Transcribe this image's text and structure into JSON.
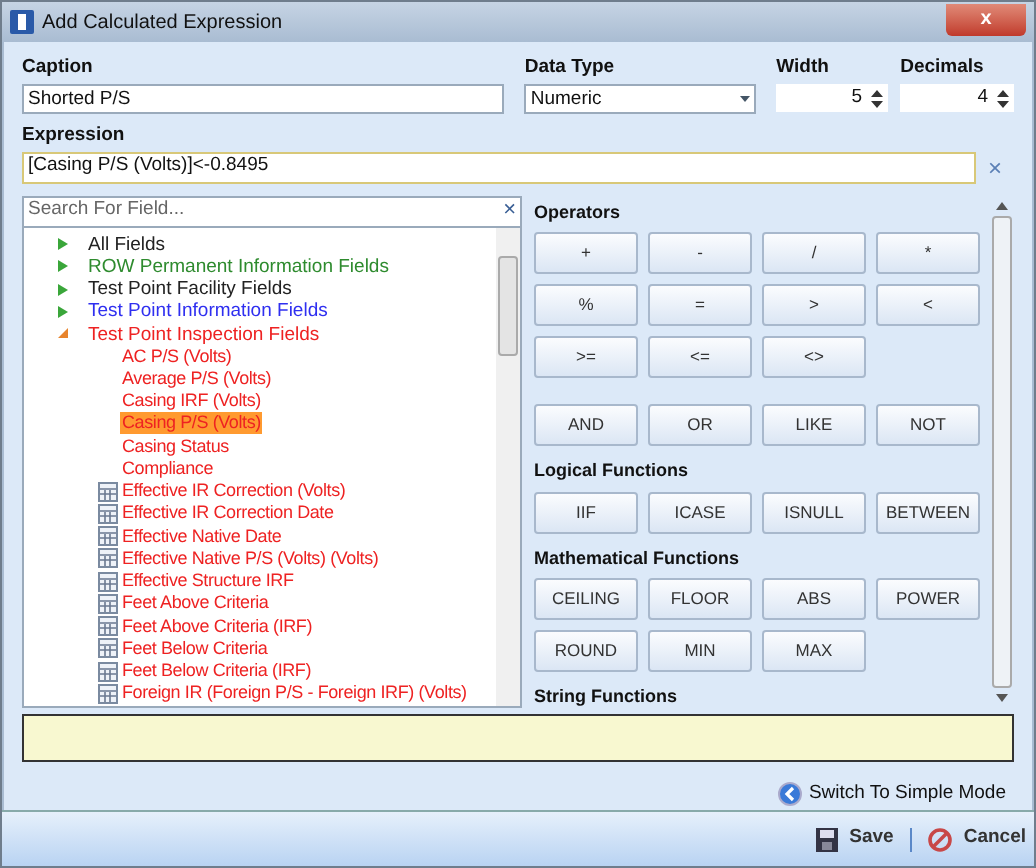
{
  "window": {
    "title": "Add Calculated Expression",
    "close": "x"
  },
  "caption": {
    "label": "Caption",
    "value": "Shorted P/S"
  },
  "data_type": {
    "label": "Data Type",
    "value": "Numeric"
  },
  "width": {
    "label": "Width",
    "value": "5"
  },
  "decimals": {
    "label": "Decimals",
    "value": "4"
  },
  "expression": {
    "label": "Expression",
    "value": "[Casing P/S (Volts)]<-0.8495",
    "clear": "×"
  },
  "search": {
    "placeholder": "Search For Field...",
    "clear": "×"
  },
  "tree": [
    {
      "label": "All Fields",
      "color": "#222222",
      "expanded": false
    },
    {
      "label": "ROW Permanent Information Fields",
      "color": "#2e8b2e",
      "expanded": false
    },
    {
      "label": "Test Point Facility Fields",
      "color": "#222222",
      "expanded": false
    },
    {
      "label": "Test Point Information Fields",
      "color": "#2f2ff0",
      "expanded": false
    },
    {
      "label": "Test Point Inspection Fields",
      "color": "#ee2222",
      "expanded": true,
      "children": [
        {
          "label": "AC P/S (Volts)",
          "kind": "plain",
          "selected": false
        },
        {
          "label": "Average P/S (Volts)",
          "kind": "plain",
          "selected": false
        },
        {
          "label": "Casing IRF (Volts)",
          "kind": "plain",
          "selected": false
        },
        {
          "label": "Casing P/S (Volts)",
          "kind": "plain",
          "selected": true
        },
        {
          "label": "Casing Status",
          "kind": "plain",
          "selected": false
        },
        {
          "label": "Compliance",
          "kind": "plain",
          "selected": false
        },
        {
          "label": "Effective IR Correction (Volts)",
          "kind": "table",
          "selected": false
        },
        {
          "label": "Effective IR Correction Date",
          "kind": "table",
          "selected": false
        },
        {
          "label": "Effective Native Date",
          "kind": "table",
          "selected": false
        },
        {
          "label": "Effective Native P/S (Volts) (Volts)",
          "kind": "table",
          "selected": false
        },
        {
          "label": "Effective Structure IRF",
          "kind": "table",
          "selected": false
        },
        {
          "label": "Feet Above Criteria",
          "kind": "table",
          "selected": false
        },
        {
          "label": "Feet Above Criteria (IRF)",
          "kind": "table",
          "selected": false
        },
        {
          "label": "Feet Below Criteria",
          "kind": "table",
          "selected": false
        },
        {
          "label": "Feet Below Criteria (IRF)",
          "kind": "table",
          "selected": false
        },
        {
          "label": "Foreign IR (Foreign P/S - Foreign IRF) (Volts)",
          "kind": "table",
          "selected": false
        }
      ]
    }
  ],
  "sections": [
    {
      "title": "Operators",
      "rows": [
        [
          "+",
          "-",
          "/",
          "*"
        ],
        [
          "%",
          "=",
          ">",
          "<"
        ],
        [
          ">=",
          "<=",
          "<>"
        ],
        [
          "AND",
          "OR",
          "LIKE",
          "NOT"
        ]
      ]
    },
    {
      "title": "Logical Functions",
      "rows": [
        [
          "IIF",
          "ICASE",
          "ISNULL",
          "BETWEEN"
        ]
      ]
    },
    {
      "title": "Mathematical Functions",
      "rows": [
        [
          "CEILING",
          "FLOOR",
          "ABS",
          "POWER"
        ],
        [
          "ROUND",
          "MIN",
          "MAX"
        ]
      ]
    },
    {
      "title": "String Functions"
    }
  ],
  "switch_mode": "Switch To Simple Mode",
  "buttons": [
    "Save",
    "Cancel"
  ]
}
